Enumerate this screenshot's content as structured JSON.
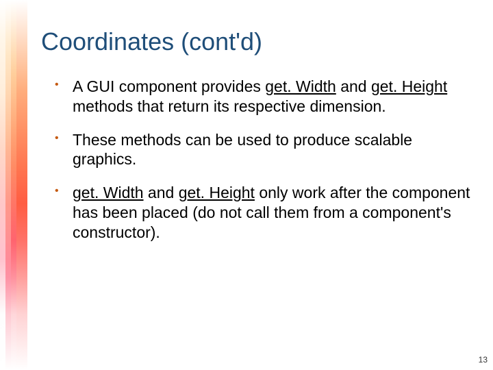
{
  "title": "Coordinates (cont'd)",
  "bullets": [
    {
      "pre": "A GUI component provides ",
      "u1": "get. Width",
      "mid": " and ",
      "u2": "get. Height",
      "post": " methods that return its respective dimension."
    },
    {
      "pre": "These methods can be used to produce scalable graphics.",
      "u1": "",
      "mid": "",
      "u2": "",
      "post": ""
    },
    {
      "pre": "",
      "u1": "get. Width",
      "mid": " and ",
      "u2": "get. Height",
      "post": " only work after the component has been placed (do not call them from a component's constructor)."
    }
  ],
  "page_number": "13"
}
